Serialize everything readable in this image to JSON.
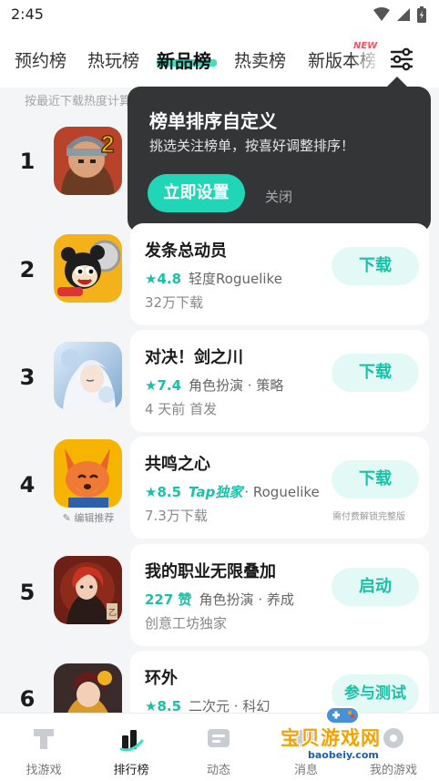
{
  "status": {
    "time": "2:45",
    "icons": [
      "wifi-icon",
      "signal-icon",
      "battery-icon"
    ]
  },
  "tabs": [
    {
      "label": "预约榜",
      "active": false
    },
    {
      "label": "热玩榜",
      "active": false
    },
    {
      "label": "新品榜",
      "active": true
    },
    {
      "label": "热卖榜",
      "active": false
    },
    {
      "label": "新版本榜",
      "active": false,
      "badge": "NEW"
    }
  ],
  "hint": "按最近下载热度计算",
  "popup": {
    "title": "榜单排序自定义",
    "desc": "挑选关注榜单，按喜好调整排序！",
    "primary": "立即设置",
    "close": "关闭"
  },
  "games": [
    {
      "rank": "1",
      "title": "",
      "score": "",
      "tags": "",
      "sub": "",
      "button": ""
    },
    {
      "rank": "2",
      "title": "发条总动员",
      "score": "★4.8",
      "tags": "轻度Roguelike",
      "sub": "32万下载",
      "button": "下载"
    },
    {
      "rank": "3",
      "title": "对决！剑之川",
      "score": "★7.4",
      "tags": "角色扮演 · 策略",
      "sub": "4 天前 首发",
      "button": "下载"
    },
    {
      "rank": "4",
      "title": "共鸣之心",
      "score": "★8.5",
      "tap_tag": "Tap独家",
      "tags": "· Roguelike",
      "sub": "7.3万下载",
      "button": "下载",
      "note": "需付费解锁完整版",
      "editor_tag": "编辑推荐"
    },
    {
      "rank": "5",
      "title": "我的职业无限叠加",
      "score": "227 赞",
      "tags": "角色扮演 · 养成",
      "sub": "创意工坊独家",
      "button": "启动"
    },
    {
      "rank": "6",
      "title": "环外",
      "score": "★8.5",
      "tags": "二次元 · 科幻",
      "sub": "",
      "button": "参与测试"
    }
  ],
  "nav": [
    {
      "label": "找游戏",
      "icon": "find-game-icon",
      "active": false
    },
    {
      "label": "排行榜",
      "icon": "ranking-icon",
      "active": true
    },
    {
      "label": "动态",
      "icon": "feed-icon",
      "active": false
    },
    {
      "label": "消息",
      "icon": "message-icon",
      "active": false
    },
    {
      "label": "我的游戏",
      "icon": "my-games-icon",
      "active": false
    }
  ],
  "watermark": {
    "text": "宝贝游戏网",
    "url": "baobeiy.com"
  },
  "colors": {
    "accent": "#18c2a8",
    "accent_light": "#e3f9f5",
    "popup_bg": "#333537",
    "badge_red": "#ff4d5e"
  }
}
